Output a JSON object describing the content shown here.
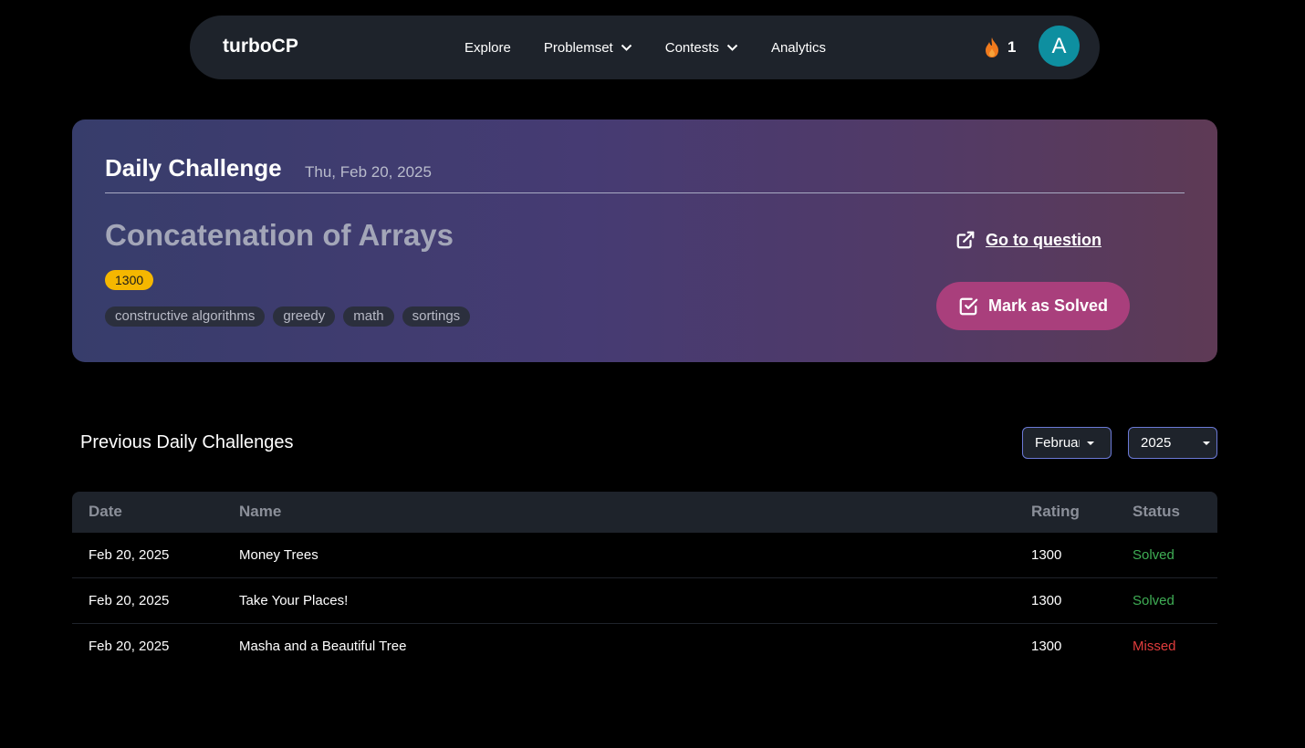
{
  "navbar": {
    "brand": "turboCP",
    "links": [
      {
        "label": "Explore",
        "dropdown": false
      },
      {
        "label": "Problemset",
        "dropdown": true
      },
      {
        "label": "Contests",
        "dropdown": true
      },
      {
        "label": "Analytics",
        "dropdown": false
      }
    ],
    "streak_count": "1",
    "avatar_initial": "A"
  },
  "daily": {
    "title": "Daily Challenge",
    "date": "Thu, Feb 20, 2025",
    "problem_name": "Concatenation of Arrays",
    "rating": "1300",
    "tags": [
      "constructive algorithms",
      "greedy",
      "math",
      "sortings"
    ],
    "goto_label": "Go to question",
    "mark_label": "Mark as Solved"
  },
  "previous": {
    "title": "Previous Daily Challenges",
    "month_select": "February",
    "year_select": "2025",
    "columns": {
      "date": "Date",
      "name": "Name",
      "rating": "Rating",
      "status": "Status"
    },
    "rows": [
      {
        "date": "Feb 20, 2025",
        "name": "Money Trees",
        "rating": "1300",
        "status": "Solved"
      },
      {
        "date": "Feb 20, 2025",
        "name": "Take Your Places!",
        "rating": "1300",
        "status": "Solved"
      },
      {
        "date": "Feb 20, 2025",
        "name": "Masha and a Beautiful Tree",
        "rating": "1300",
        "status": "Missed"
      }
    ]
  },
  "colors": {
    "solved": "#3fae55",
    "missed": "#e03c3c",
    "accent_button": "#a93f7c",
    "rating_badge": "#f5b700",
    "avatar": "#0e8fa0"
  },
  "icons": {
    "streak": "fire-icon",
    "goto": "external-link-icon",
    "mark": "checkbox-check-icon",
    "dropdown": "chevron-down-icon"
  }
}
